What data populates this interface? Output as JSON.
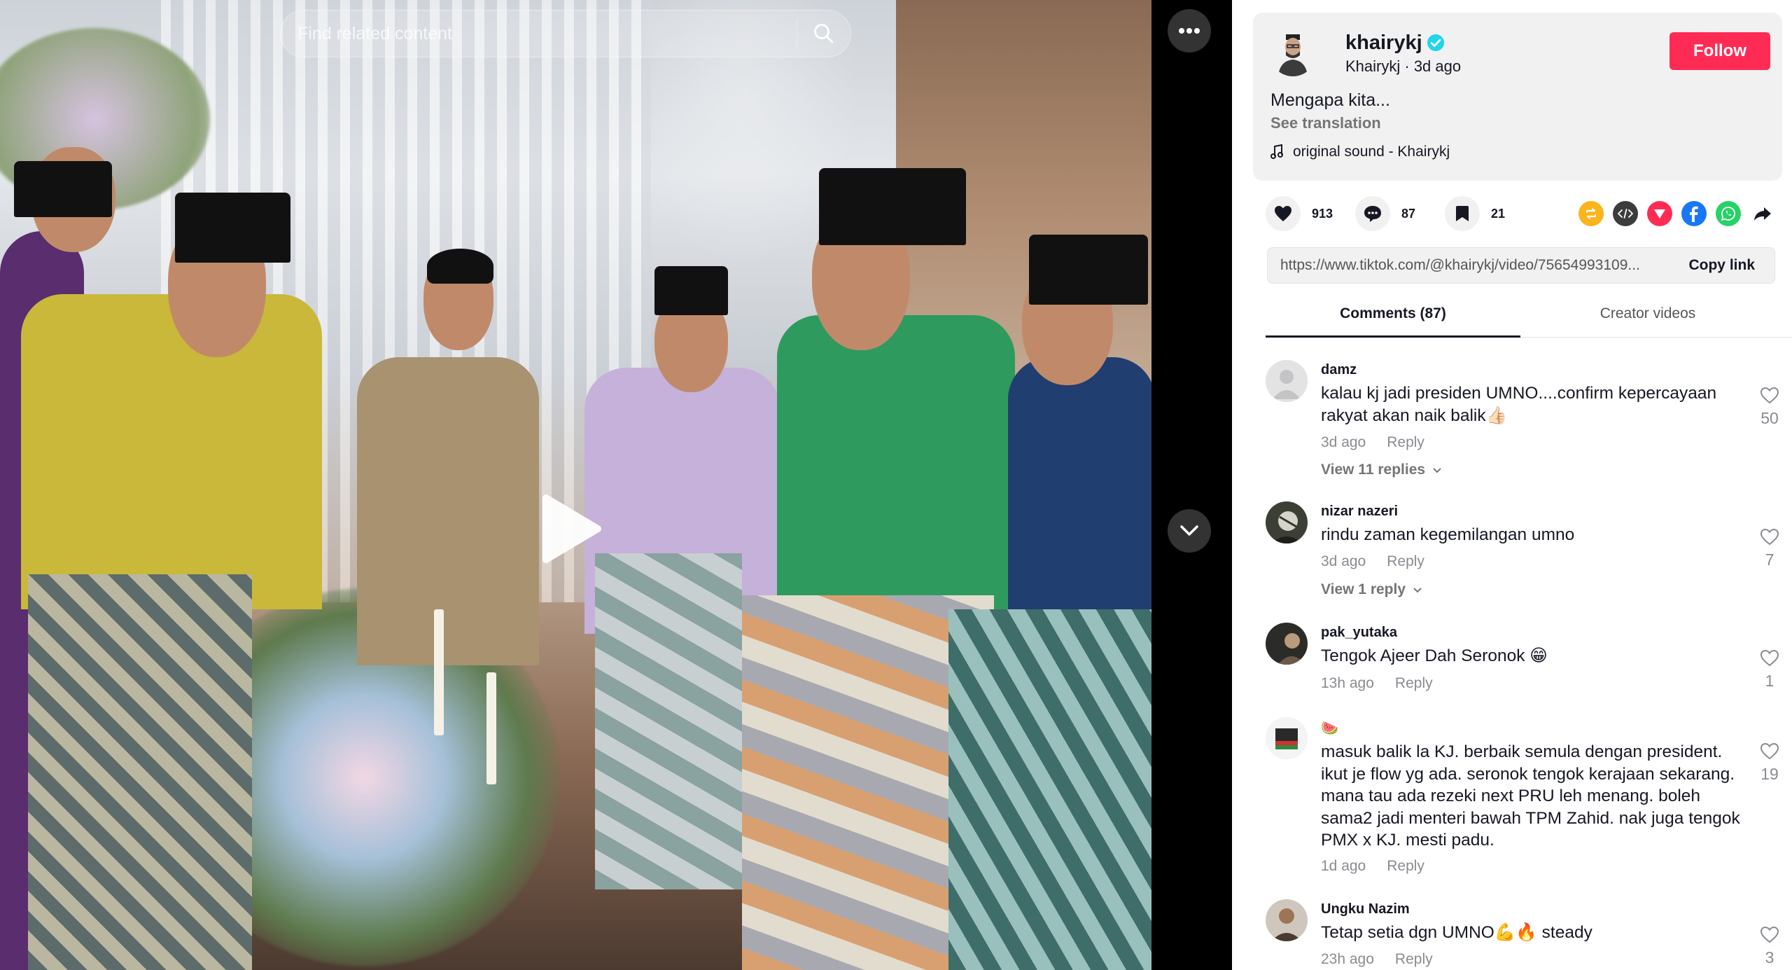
{
  "search": {
    "placeholder": "Find related content"
  },
  "author": {
    "username": "khairykj",
    "display_name": "Khairykj",
    "posted": "3d ago",
    "separator": " · ",
    "follow_label": "Follow",
    "caption": "Mengapa kita...",
    "see_translation": "See translation",
    "music": "original sound - Khairykj"
  },
  "stats": {
    "likes": "913",
    "comments": "87",
    "saves": "21"
  },
  "share_icons": [
    "repost-icon",
    "embed-icon",
    "send-icon",
    "facebook-icon",
    "whatsapp-icon",
    "share-arrow-icon"
  ],
  "link": {
    "url": "https://www.tiktok.com/@khairykj/video/75654993109...",
    "copy_label": "Copy link"
  },
  "tabs": [
    {
      "label": "Comments (87)"
    },
    {
      "label": "Creator videos"
    }
  ],
  "comments": [
    {
      "user": "damz",
      "text": "kalau kj jadi presiden UMNO....confirm kepercayaan rakyat akan naik balik👍🏻",
      "time": "3d ago",
      "reply": "Reply",
      "likes": "50",
      "view_replies": "View 11 replies"
    },
    {
      "user": "nizar nazeri",
      "text": "rindu zaman kegemilangan umno",
      "time": "3d ago",
      "reply": "Reply",
      "likes": "7",
      "view_replies": "View 1 reply"
    },
    {
      "user": "pak_yutaka",
      "text": "Tengok Ajeer Dah Seronok 😁",
      "time": "13h ago",
      "reply": "Reply",
      "likes": "1"
    },
    {
      "user": "🍉",
      "text": "masuk balik la KJ. berbaik semula dengan president. ikut je flow yg ada. seronok tengok kerajaan sekarang. mana tau ada rezeki next PRU leh menang. boleh sama2 jadi menteri bawah TPM Zahid. nak juga tengok PMX x KJ. mesti padu.",
      "time": "1d ago",
      "reply": "Reply",
      "likes": "19"
    },
    {
      "user": "Ungku Nazim",
      "text": "Tetap setia dgn UMNO💪🔥 steady",
      "time": "23h ago",
      "reply": "Reply",
      "likes": "3"
    }
  ],
  "colors": {
    "follow": "#fe2c55",
    "verified": "#20d5ec",
    "text": "#161823",
    "muted": "#8a8b91"
  }
}
